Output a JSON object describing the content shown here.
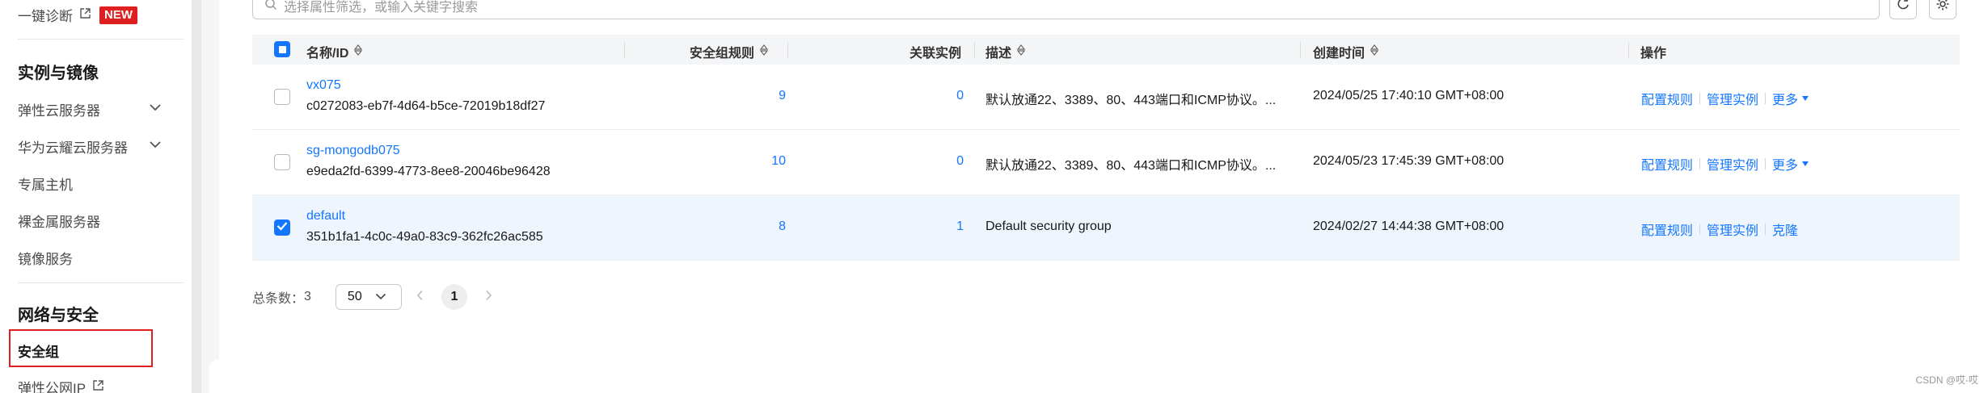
{
  "sidebar": {
    "diag_label": "一键诊断",
    "diag_badge": "NEW",
    "section_instances": "实例与镜像",
    "items_instances": [
      {
        "label": "弹性云服务器"
      },
      {
        "label": "华为云耀云服务器"
      },
      {
        "label": "专属主机"
      },
      {
        "label": "裸金属服务器"
      },
      {
        "label": "镜像服务"
      }
    ],
    "section_network": "网络与安全",
    "active_item": "安全组",
    "eip_label": "弹性公网IP"
  },
  "search": {
    "placeholder": "选择属性筛选，或输入关键字搜索"
  },
  "table": {
    "headers": {
      "name": "名称/ID",
      "rules": "安全组规则",
      "instances": "关联实例",
      "desc": "描述",
      "created": "创建时间",
      "ops": "操作"
    },
    "rows": [
      {
        "name": "vx075",
        "id": "c0272083-eb7f-4d64-b5ce-72019b18df27",
        "rules": "9",
        "instances": "0",
        "desc": "默认放通22、3389、80、443端口和ICMP协议。...",
        "created": "2024/05/25 17:40:10 GMT+08:00",
        "op1": "配置规则",
        "op2": "管理实例",
        "op3": "更多"
      },
      {
        "name": "sg-mongodb075",
        "id": "e9eda2fd-6399-4773-8ee8-20046be96428",
        "rules": "10",
        "instances": "0",
        "desc": "默认放通22、3389、80、443端口和ICMP协议。...",
        "created": "2024/05/23 17:45:39 GMT+08:00",
        "op1": "配置规则",
        "op2": "管理实例",
        "op3": "更多"
      },
      {
        "name": "default",
        "id": "351b1fa1-4c0c-49a0-83c9-362fc26ac585",
        "rules": "8",
        "instances": "1",
        "desc": "Default security group",
        "created": "2024/02/27 14:44:38 GMT+08:00",
        "op1": "配置规则",
        "op2": "管理实例",
        "op3": "克隆"
      }
    ]
  },
  "pager": {
    "total_label": "总条数：",
    "total": "3",
    "page_size": "50",
    "current_page": "1"
  },
  "watermark": "CSDN @哎-哎",
  "colors": {
    "accent": "#1476ff",
    "badge": "#e02020",
    "selected_row": "#eef5fd"
  }
}
